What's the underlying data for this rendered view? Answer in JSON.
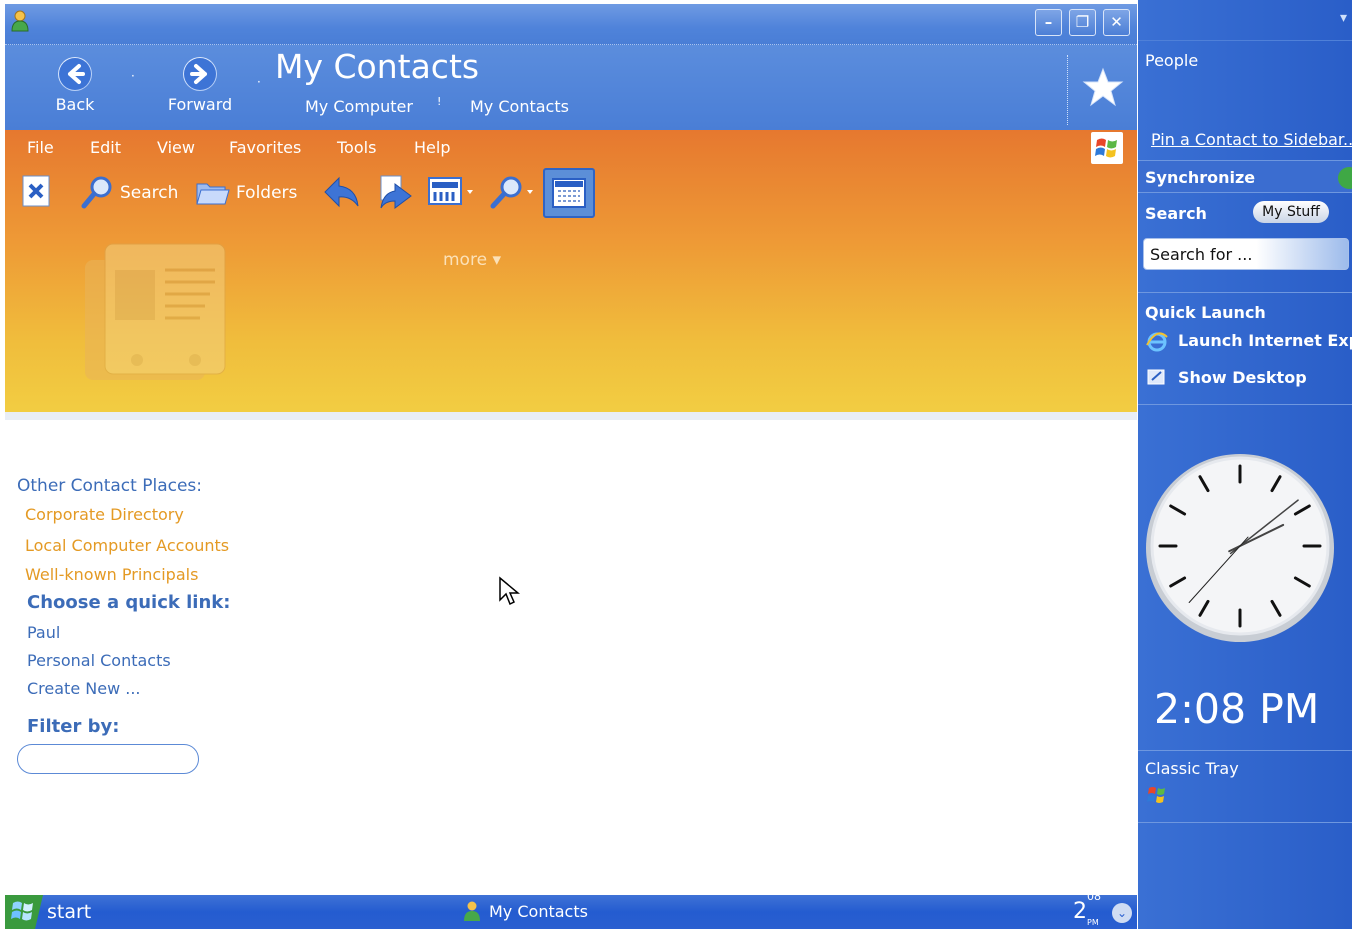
{
  "window": {
    "title": "My Contacts",
    "nav": {
      "back": "Back",
      "forward": "Forward"
    },
    "breadcrumb": [
      "My Computer",
      "My Contacts"
    ]
  },
  "menu": [
    "File",
    "Edit",
    "View",
    "Favorites",
    "Tools",
    "Help"
  ],
  "toolbar": {
    "search_label": "Search",
    "folders_label": "Folders",
    "more_label": "more"
  },
  "content": {
    "other_places_heading": "Other Contact Places:",
    "other_places": [
      "Corporate Directory",
      "Local Computer Accounts",
      "Well-known Principals"
    ],
    "quick_link_heading": "Choose a quick link:",
    "quick_links": [
      "Paul",
      "Personal Contacts",
      "Create New ..."
    ],
    "filter_heading": "Filter by:",
    "filter_value": ""
  },
  "taskbar": {
    "start_label": "start",
    "task_item": "My Contacts",
    "tray_hour": "2",
    "tray_minutes": "08",
    "tray_ampm": "PM"
  },
  "sidebar": {
    "people_title": "People",
    "pin_link": "Pin a Contact to Sidebar...",
    "synchronize_title": "Synchronize",
    "search_title": "Search",
    "search_scope": "My Stuff",
    "search_placeholder": "Search for ...",
    "quick_launch_title": "Quick Launch",
    "quick_launch_items": [
      "Launch Internet Explorer",
      "Show Desktop"
    ],
    "clock_time": "2:08 PM",
    "clock_value": {
      "hour": 2,
      "minute": 8,
      "second": 37
    },
    "classic_tray_title": "Classic Tray"
  },
  "colors": {
    "title_blue": "#4f83da",
    "orange_top": "#e6782f",
    "orange_bottom": "#f2cd42",
    "link_orange": "#e49a24",
    "link_blue": "#3c6cb8",
    "sidebar_blue": "#2a5ec8"
  },
  "icons": [
    "contact-app-icon",
    "back-arrow-icon",
    "forward-arrow-icon",
    "favorite-star-icon",
    "windows-flag-icon",
    "delete-contact-icon",
    "search-icon",
    "folders-icon",
    "reply-icon",
    "forward-mail-icon",
    "view-grid-icon",
    "find-icon",
    "calendar-icon",
    "contact-folder-illustration",
    "mouse-cursor-icon"
  ]
}
